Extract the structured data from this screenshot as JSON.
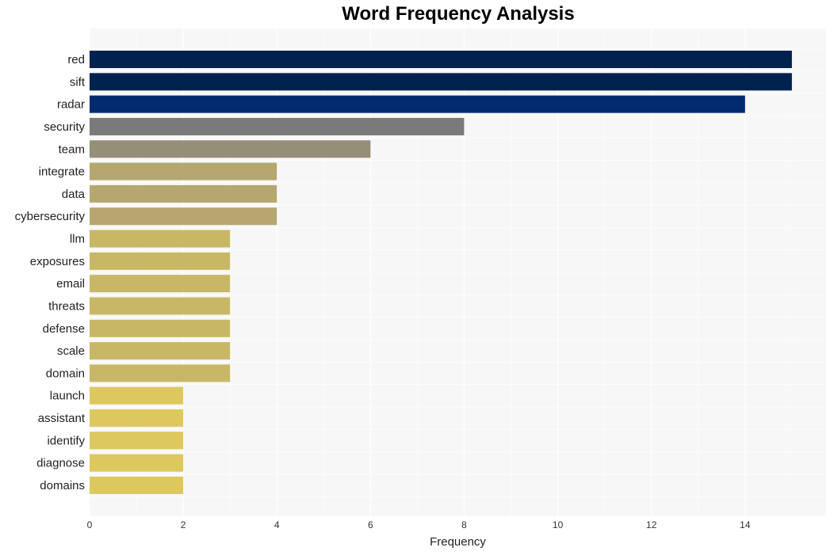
{
  "chart_data": {
    "type": "bar",
    "orientation": "horizontal",
    "title": "Word Frequency Analysis",
    "xlabel": "Frequency",
    "ylabel": "",
    "xlim": [
      0,
      15.73
    ],
    "xticks": [
      0,
      2,
      4,
      6,
      8,
      10,
      12,
      14
    ],
    "grid": true,
    "categories": [
      "red",
      "sift",
      "radar",
      "security",
      "team",
      "integrate",
      "data",
      "cybersecurity",
      "llm",
      "exposures",
      "email",
      "threats",
      "defense",
      "scale",
      "domain",
      "launch",
      "assistant",
      "identify",
      "diagnose",
      "domains"
    ],
    "values": [
      15,
      15,
      14,
      8,
      6,
      4,
      4,
      4,
      3,
      3,
      3,
      3,
      3,
      3,
      3,
      2,
      2,
      2,
      2,
      2
    ],
    "colors": [
      "#00224e",
      "#00224e",
      "#002b6e",
      "#7a7a7a",
      "#958e78",
      "#b5a76f",
      "#b5a76f",
      "#b5a76f",
      "#c8b866",
      "#c8b866",
      "#c8b866",
      "#c8b866",
      "#c8b866",
      "#c8b866",
      "#c8b866",
      "#dcc85e",
      "#dcc85e",
      "#dcc85e",
      "#dcc85e",
      "#dcc85e"
    ],
    "background": "#f7f7f7"
  }
}
